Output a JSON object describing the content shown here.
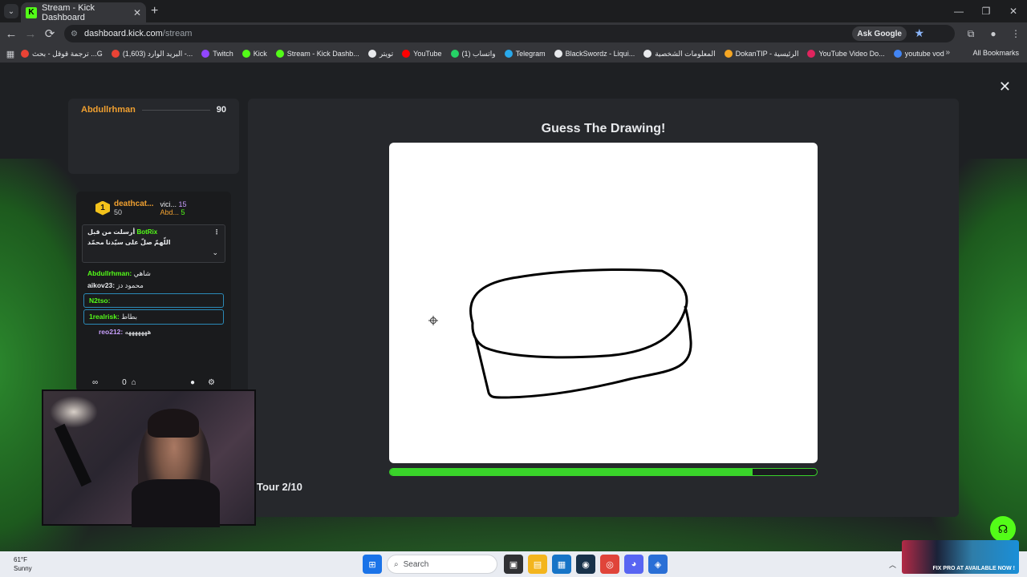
{
  "browser": {
    "tab_title": "Stream - Kick Dashboard",
    "url_host": "dashboard.kick.com",
    "url_path": "/stream",
    "ask_google": "Ask Google",
    "bookmarks": [
      {
        "label": "ترجمة قوقل - بحث ...G",
        "color": "#ea4335"
      },
      {
        "label": "(1,603) البريد الوارد -...",
        "color": "#ea4335"
      },
      {
        "label": "Twitch",
        "color": "#9146ff"
      },
      {
        "label": "Kick",
        "color": "#53fc18"
      },
      {
        "label": "Stream - Kick Dashb...",
        "color": "#53fc18"
      },
      {
        "label": "تويتر",
        "color": "#e8eaed"
      },
      {
        "label": "YouTube",
        "color": "#ff0000"
      },
      {
        "label": "واتساب (1)",
        "color": "#25d366"
      },
      {
        "label": "Telegram",
        "color": "#29a9eb"
      },
      {
        "label": "BlackSwordz - Liqui...",
        "color": "#e8eaed"
      },
      {
        "label": "المعلومات الشخصية",
        "color": "#e8eaed"
      },
      {
        "label": "DokanTIP - الرئيسية",
        "color": "#f5a623"
      },
      {
        "label": "YouTube Video Do...",
        "color": "#e0245e"
      },
      {
        "label": "youtube vod",
        "color": "#4285f4"
      }
    ],
    "all_bookmarks": "All Bookmarks"
  },
  "leaderboard": {
    "top_name": "Abdullrhman",
    "top_score": "90"
  },
  "game": {
    "title": "Guess The Drawing!",
    "round": "Tour 2/10",
    "progress_fraction": 0.85
  },
  "chat": {
    "leader_name": "deathcat...",
    "leader_score": "50",
    "rank_badge": "1",
    "side_1_name": "vici...",
    "side_1_score": "15",
    "side_2_name": "Abd...",
    "side_2_score": "5",
    "pinned_by": "أرسلت من قبل",
    "pinned_user": "BotRix",
    "pinned_text": "اللّهمّ صلّ على سيّدنا محمّد",
    "messages": [
      {
        "user": "Abdullrhman:",
        "text": "شاهي",
        "color": "#53fc18"
      },
      {
        "user": "aikov23:",
        "text": "محمود دز",
        "color": "#e8eaed"
      },
      {
        "user": "N2tso:",
        "text": "",
        "color": "#53fc18"
      },
      {
        "user": "1realrisk:",
        "text": "بطاط",
        "color": "#53fc18"
      },
      {
        "user": "reo212:",
        "text": "هههههههه",
        "color": "#c79ffc"
      }
    ],
    "footer_count": "0"
  },
  "taskbar": {
    "weather_temp": "61°F",
    "weather_desc": "Sunny",
    "search_placeholder": "Search",
    "promo_text": "FIX PRO AT AVAILABLE NOW !"
  }
}
